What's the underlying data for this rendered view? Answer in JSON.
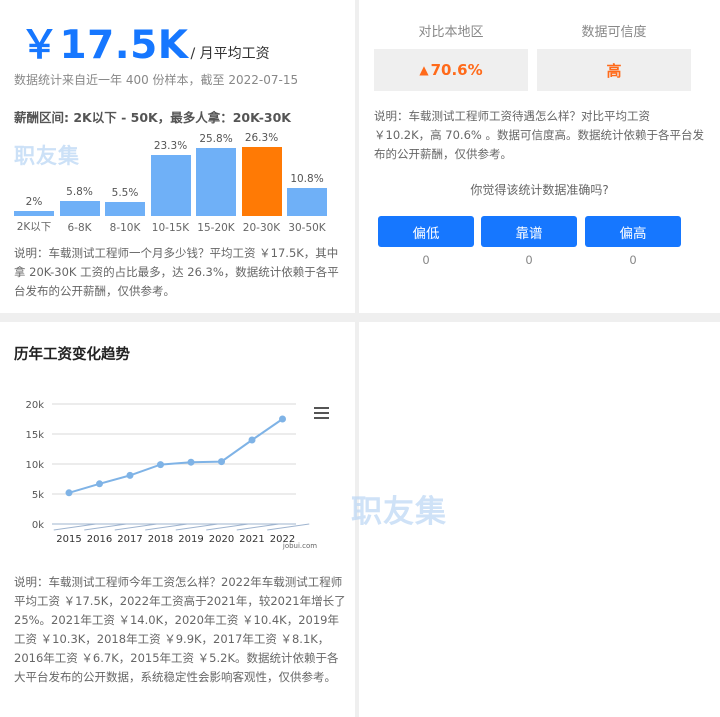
{
  "salary": {
    "avg_value": "￥17.5K",
    "avg_unit": "/ 月平均工资",
    "sample_note": "数据统计来自近一年 400 份样本，截至 2022-07-15",
    "range_line": "薪酬区间: 2K以下 - 50K，最多人拿：20K-30K",
    "watermark": "职友集",
    "distribution": [
      {
        "label": "2K以下",
        "pct": "2%",
        "value": 2,
        "active": false
      },
      {
        "label": "6-8K",
        "pct": "5.8%",
        "value": 5.8,
        "active": false
      },
      {
        "label": "8-10K",
        "pct": "5.5%",
        "value": 5.5,
        "active": false
      },
      {
        "label": "10-15K",
        "pct": "23.3%",
        "value": 23.3,
        "active": false
      },
      {
        "label": "15-20K",
        "pct": "25.8%",
        "value": 25.8,
        "active": false
      },
      {
        "label": "20-30K",
        "pct": "26.3%",
        "value": 26.3,
        "active": true
      },
      {
        "label": "30-50K",
        "pct": "10.8%",
        "value": 10.8,
        "active": false
      }
    ],
    "bar_color": "#6fb0f7",
    "active_color": "#ff7a05",
    "explain": "说明：车载测试工程师一个月多少钱？平均工资 ￥17.5K，其中拿 20K-30K 工资的占比最多，达 26.3%，数据统计依赖于各平台发布的公开薪酬，仅供参考。"
  },
  "compare": {
    "region_label": "对比本地区",
    "region_value": "70.6%",
    "region_icon": "arrow-up-icon",
    "trust_label": "数据可信度",
    "trust_value": "高",
    "explain": "说明：车载测试工程师工资待遇怎么样？对比平均工资 ￥10.2K，高 70.6% 。数据可信度高。数据统计依赖于各平台发布的公开薪酬，仅供参考。",
    "question": "你觉得该统计数据准确吗?",
    "votes": [
      {
        "label": "偏低",
        "count": "0"
      },
      {
        "label": "靠谱",
        "count": "0"
      },
      {
        "label": "偏高",
        "count": "0"
      }
    ],
    "accent": "#1677ff",
    "highlight": "#ff6a1a"
  },
  "trend": {
    "title": "历年工资变化趋势",
    "menu_icon": "hamburger-menu-icon",
    "watermark": "职友集",
    "explain": "说明：车载测试工程师今年工资怎么样？2022年车载测试工程师平均工资 ￥17.5K，2022年工资高于2021年，较2021年增长了25%。2021年工资 ￥14.0K，2020年工资 ￥10.4K，2019年工资 ￥10.3K，2018年工资 ￥9.9K，2017年工资 ￥8.1K，2016年工资 ￥6.7K，2015年工资 ￥5.2K。数据统计依赖于各大平台发布的公开数据，系统稳定性会影响客观性，仅供参考。"
  },
  "chart_data": {
    "type": "line",
    "x": [
      "2015",
      "2016",
      "2017",
      "2018",
      "2019",
      "2020",
      "2021",
      "2022"
    ],
    "series": [
      {
        "values": [
          5.2,
          6.7,
          8.1,
          9.9,
          10.3,
          10.4,
          14.0,
          17.5
        ]
      }
    ],
    "yticks": [
      "0k",
      "5k",
      "10k",
      "15k",
      "20k"
    ],
    "ylim": [
      0,
      20
    ],
    "grid": true,
    "credit": "jobui.com",
    "line_color": "#7fb3e6",
    "xlabel": "",
    "ylabel": "",
    "title": ""
  }
}
